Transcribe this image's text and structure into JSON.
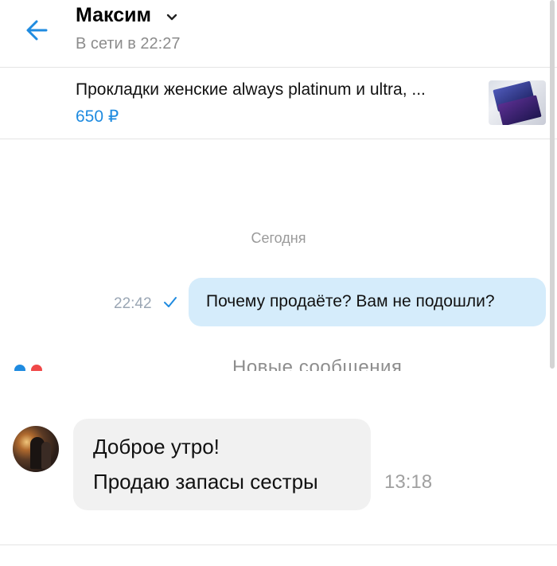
{
  "header": {
    "contact_name": "Максим",
    "status": "В сети в 22:27"
  },
  "product": {
    "title": "Прокладки женские always platinum и ultra, ...",
    "price": "650 ₽"
  },
  "conversation": {
    "date_separator": "Сегодня",
    "outgoing": {
      "time": "22:42",
      "text": "Почему продаёте? Вам не подошли?"
    },
    "new_messages_label": "Новые сообщения",
    "incoming": {
      "lines": [
        "Доброе утро!",
        "Продаю запасы сестры"
      ],
      "time": "13:18"
    }
  },
  "icons": {
    "back": "arrow-left-icon",
    "dropdown": "chevron-down-icon",
    "read_check": "check-icon"
  },
  "colors": {
    "accent": "#1f8be0",
    "outgoing_bubble": "#d5ecfb",
    "incoming_bubble": "#f1f1f1",
    "muted_text": "#8c8c8c"
  }
}
